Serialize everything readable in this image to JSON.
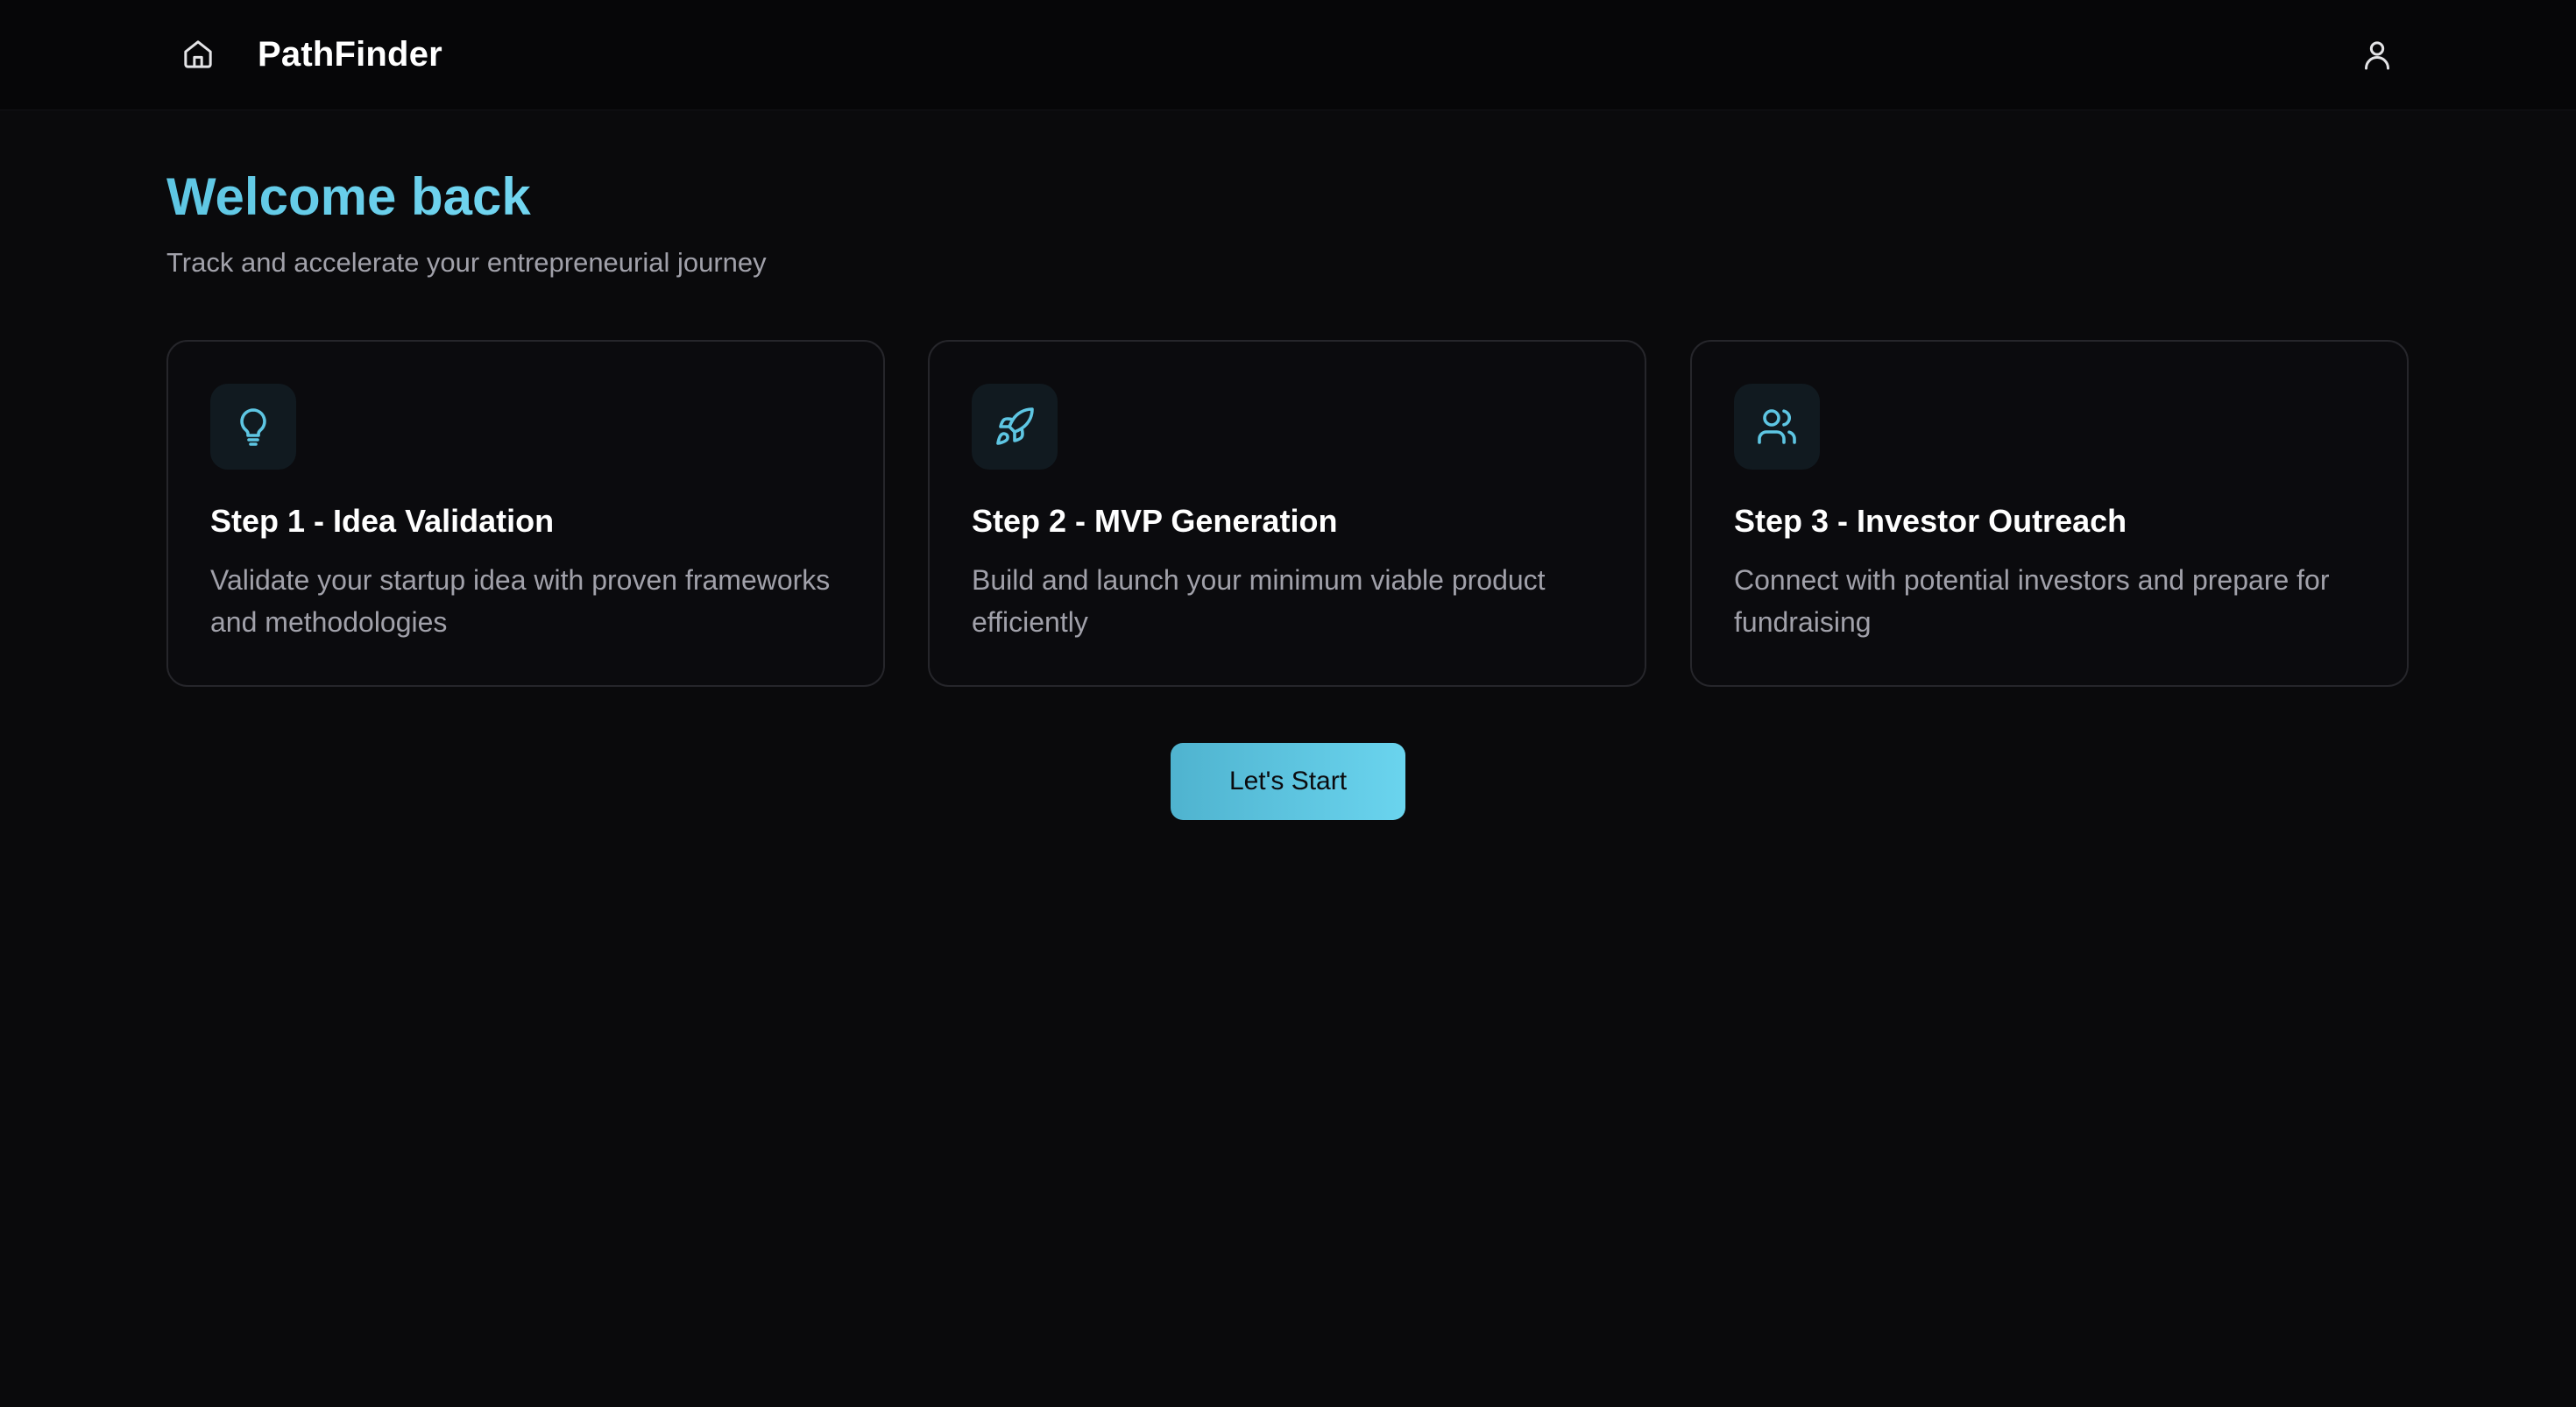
{
  "header": {
    "home_icon": "home-icon",
    "brand": "PathFinder",
    "user_icon": "user-icon"
  },
  "main": {
    "title": "Welcome back",
    "subtitle": "Track and accelerate your entrepreneurial journey",
    "steps": [
      {
        "icon": "lightbulb-icon",
        "title": "Step 1 - Idea Validation",
        "description": "Validate your startup idea with proven frameworks and methodologies"
      },
      {
        "icon": "rocket-icon",
        "title": "Step 2 - MVP Generation",
        "description": "Build and launch your minimum viable product efficiently"
      },
      {
        "icon": "users-icon",
        "title": "Step 3 - Investor Outreach",
        "description": "Connect with potential investors and prepare for fundraising"
      }
    ],
    "cta_label": "Let's Start"
  },
  "colors": {
    "background": "#0a0a0c",
    "header_background": "#060608",
    "accent": "#6ad1ee",
    "muted_text": "#a1a1aa",
    "card_border": "#26262b"
  }
}
